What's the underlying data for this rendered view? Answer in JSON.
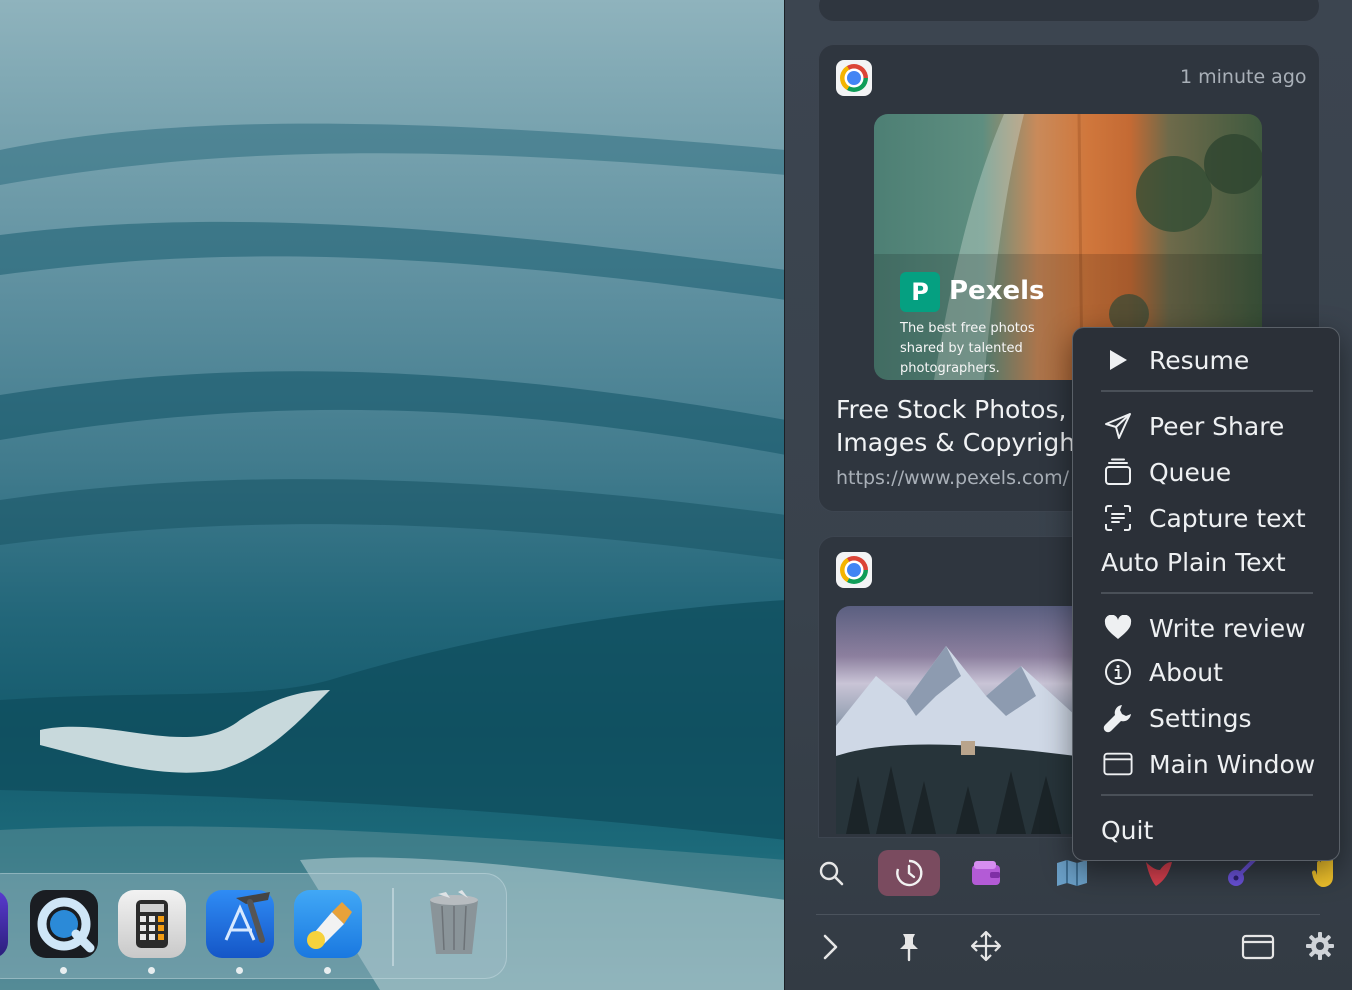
{
  "cards": [
    {
      "time": "1 minute ago",
      "preview_brand": "Pexels",
      "preview_tagline": "The best free photos shared by talented photographers.",
      "title": "Free Stock Photos,\nImages & Copyright",
      "url": "https://www.pexels.com/"
    },
    {
      "time": ""
    }
  ],
  "menu": {
    "items": [
      {
        "label": "Resume",
        "icon": "play-icon"
      },
      {
        "label": "Peer Share",
        "icon": "paper-plane-icon"
      },
      {
        "label": "Queue",
        "icon": "stack-icon"
      },
      {
        "label": "Capture text",
        "icon": "text-scan-icon"
      },
      {
        "label": "Auto Plain Text",
        "icon": ""
      },
      {
        "label": "Write review",
        "icon": "heart-icon"
      },
      {
        "label": "About",
        "icon": "info-icon"
      },
      {
        "label": "Settings",
        "icon": "wrench-icon"
      },
      {
        "label": "Main Window",
        "icon": "window-icon"
      },
      {
        "label": "Quit",
        "icon": ""
      }
    ]
  },
  "toolbar": {
    "top": [
      "search-icon",
      "history-clock-icon",
      "wallet-icon",
      "map-icon",
      "bird-icon",
      "guitar-icon",
      "hand-icon"
    ],
    "bottom": [
      "chevron-right-icon",
      "pin-icon",
      "move-icon",
      "window-icon",
      "gear-icon"
    ]
  },
  "colors": {
    "panel_bg": "#3a434d",
    "menu_bg": "#2b3038",
    "active_tab": "#7a4b5f",
    "wallet": "#b35bd6",
    "map": "#6ba0c8",
    "bird": "#d9404f",
    "guitar": "#6a52d9",
    "hand": "#f0c22c"
  },
  "dock": [
    "quicktime-icon",
    "calculator-icon",
    "xcode-icon",
    "glue-app-icon",
    "trash-icon"
  ]
}
